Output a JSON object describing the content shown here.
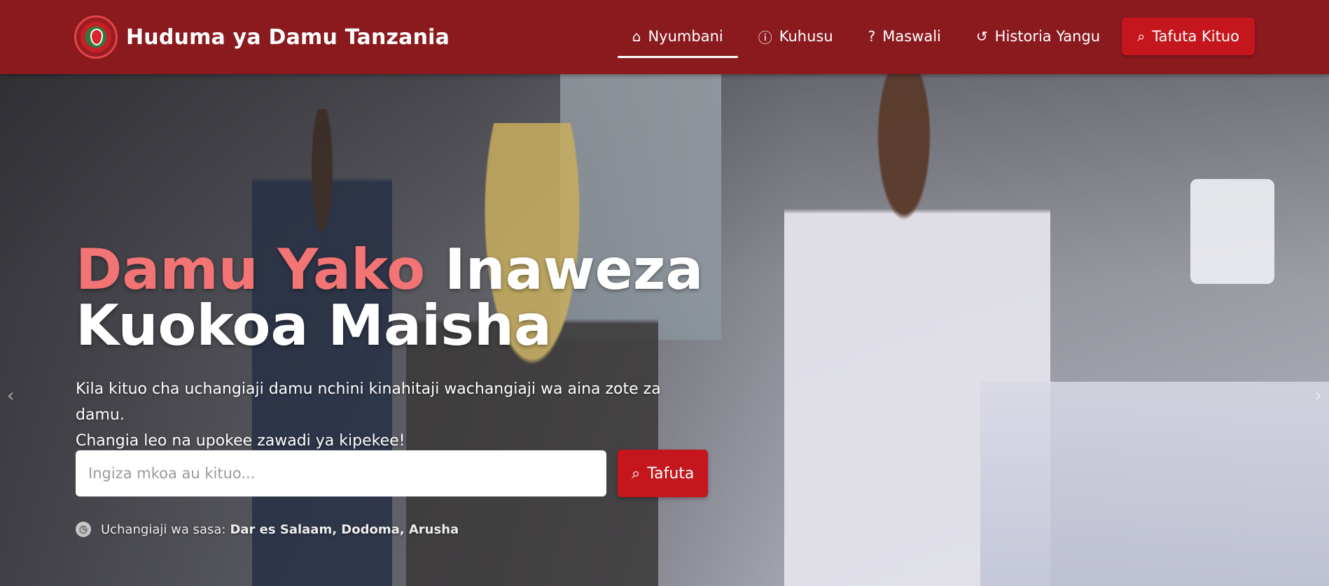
{
  "brand": {
    "name": "Huduma ya Damu Tanzania",
    "logo_icon": "blood-drop-logo"
  },
  "nav": {
    "items": [
      {
        "label": "Nyumbani",
        "icon": "home-icon",
        "active": true
      },
      {
        "label": "Kuhusu",
        "icon": "info-icon",
        "active": false
      },
      {
        "label": "Maswali",
        "icon": "question-icon",
        "active": false
      },
      {
        "label": "Historia Yangu",
        "icon": "history-icon",
        "active": false
      }
    ],
    "cta": {
      "label": "Tafuta Kituo",
      "icon": "search-zoom-icon"
    }
  },
  "hero": {
    "headline_highlight": "Damu Yako",
    "headline_rest_line1": "Inaweza",
    "headline_line2": "Kuokoa Maisha",
    "subtitle_line1": "Kila kituo cha uchangiaji damu nchini kinahitaji wachangiaji wa aina zote za damu.",
    "subtitle_line2": "Changia leo na upokee zawadi ya kipekee!",
    "search": {
      "placeholder": "Ingiza mkoa au kituo...",
      "value": "",
      "button_label": "Tafuta"
    },
    "recent_label": "Uchangiaji wa sasa:",
    "recent_places": "Dar es Salaam, Dodoma, Arusha",
    "carousel_prev": "‹",
    "carousel_next": "›"
  },
  "colors": {
    "navbar": "#8b1a1f",
    "accent": "#c4161c",
    "highlight": "#f27474"
  }
}
